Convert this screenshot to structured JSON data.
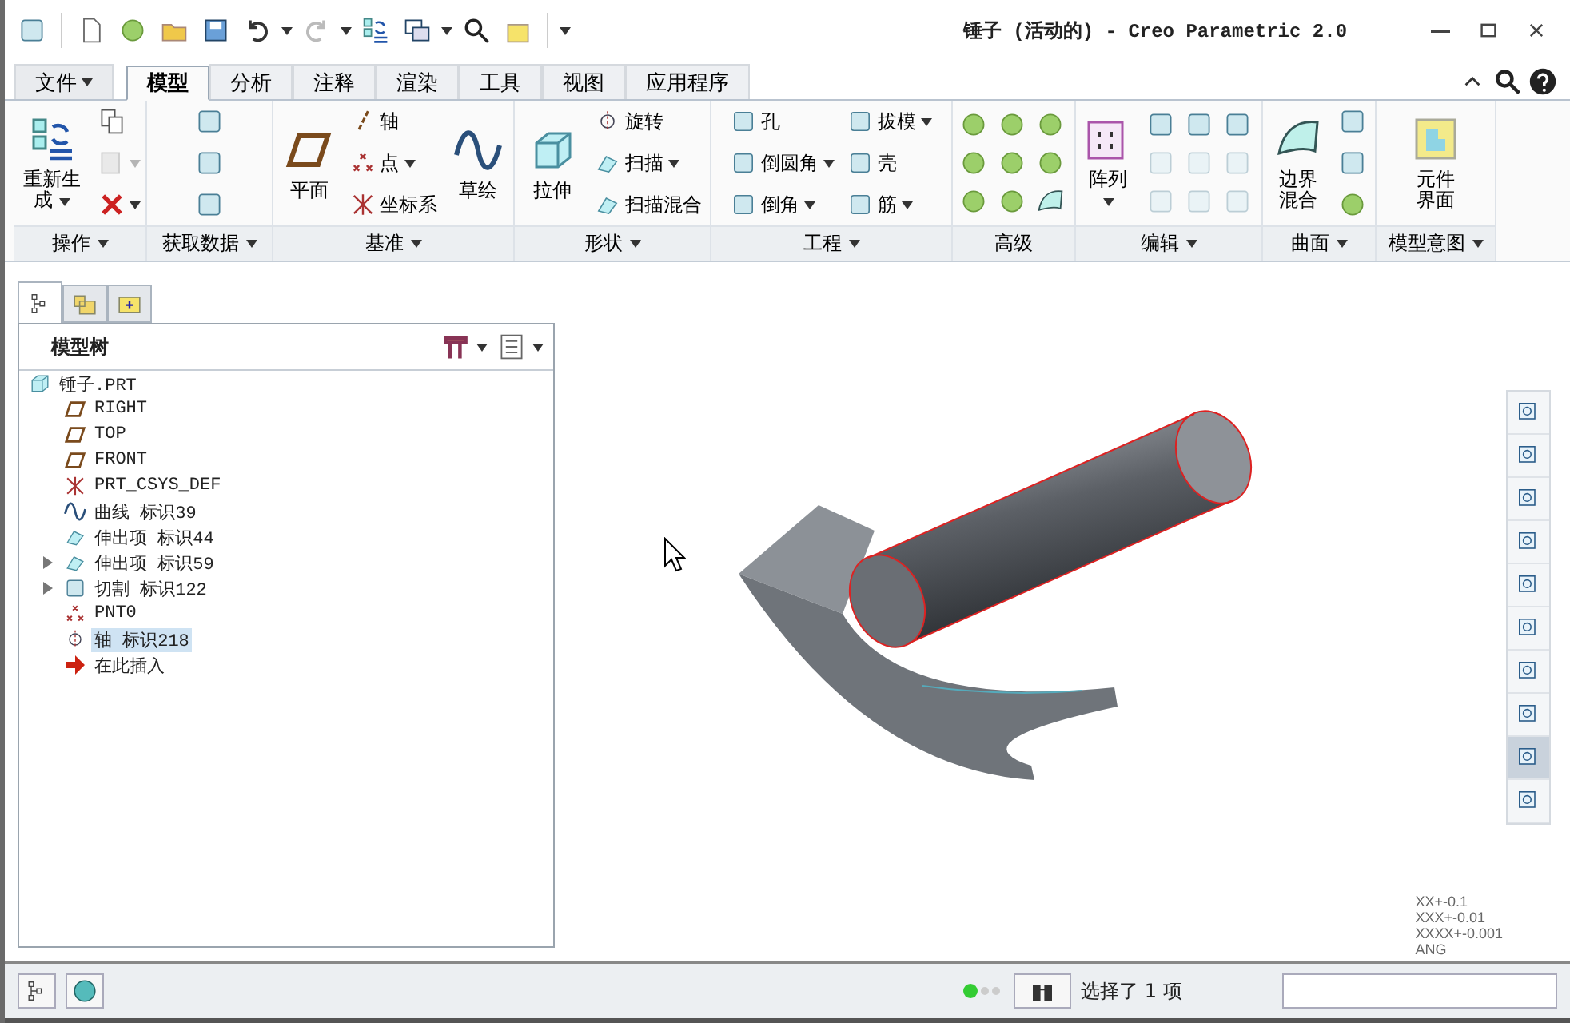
{
  "window": {
    "title": "锤子 (活动的) - Creo Parametric 2.0"
  },
  "menu_tabs": [
    {
      "label": "文件",
      "kind": "menu",
      "selected": false
    },
    {
      "label": "模型",
      "kind": "tab",
      "selected": true
    },
    {
      "label": "分析",
      "kind": "tab",
      "selected": false
    },
    {
      "label": "注释",
      "kind": "tab",
      "selected": false
    },
    {
      "label": "渲染",
      "kind": "tab",
      "selected": false
    },
    {
      "label": "工具",
      "kind": "tab",
      "selected": false
    },
    {
      "label": "视图",
      "kind": "tab",
      "selected": false
    },
    {
      "label": "应用程序",
      "kind": "tab",
      "selected": false
    }
  ],
  "ribbon": {
    "groups": [
      {
        "label": "操作",
        "dropdown": true,
        "items": [
          {
            "kind": "large",
            "label": "重新生成",
            "dropdown": true
          },
          {
            "kind": "icon",
            "dropdown": false,
            "disabled": false
          },
          {
            "kind": "icon",
            "dropdown": true,
            "disabled": true
          },
          {
            "kind": "icon",
            "dropdown": true,
            "disabled": false
          }
        ]
      },
      {
        "label": "获取数据",
        "dropdown": true,
        "items": [
          {
            "kind": "icon",
            "dropdown": false,
            "disabled": false
          },
          {
            "kind": "icon",
            "dropdown": false,
            "disabled": false
          },
          {
            "kind": "icon",
            "dropdown": false,
            "disabled": false
          }
        ]
      },
      {
        "label": "基准",
        "dropdown": true,
        "items": [
          {
            "kind": "large",
            "label": "平面",
            "dropdown": false
          },
          {
            "kind": "small",
            "label": "轴",
            "dropdown": false
          },
          {
            "kind": "small",
            "label": "点",
            "dropdown": true
          },
          {
            "kind": "small",
            "label": "坐标系",
            "dropdown": false
          },
          {
            "kind": "large",
            "label": "草绘",
            "dropdown": false
          }
        ]
      },
      {
        "label": "形状",
        "dropdown": true,
        "items": [
          {
            "kind": "large",
            "label": "拉伸",
            "dropdown": false
          },
          {
            "kind": "small",
            "label": "旋转",
            "dropdown": false
          },
          {
            "kind": "small",
            "label": "扫描",
            "dropdown": true
          },
          {
            "kind": "small",
            "label": "扫描混合",
            "dropdown": false
          }
        ]
      },
      {
        "label": "工程",
        "dropdown": true,
        "items": [
          {
            "kind": "small",
            "label": "孔",
            "dropdown": false
          },
          {
            "kind": "small",
            "label": "倒圆角",
            "dropdown": true
          },
          {
            "kind": "small",
            "label": "倒角",
            "dropdown": true
          },
          {
            "kind": "small",
            "label": "拔模",
            "dropdown": true
          },
          {
            "kind": "small",
            "label": "壳",
            "dropdown": false
          },
          {
            "kind": "small",
            "label": "筋",
            "dropdown": true
          }
        ]
      },
      {
        "label": "高级",
        "dropdown": false,
        "items": [
          {
            "kind": "icon",
            "dropdown": false,
            "disabled": false
          },
          {
            "kind": "icon",
            "dropdown": false,
            "disabled": false
          },
          {
            "kind": "icon",
            "dropdown": false,
            "disabled": false
          },
          {
            "kind": "icon",
            "dropdown": false,
            "disabled": false
          },
          {
            "kind": "icon",
            "dropdown": false,
            "disabled": false
          },
          {
            "kind": "icon",
            "dropdown": false,
            "disabled": false
          },
          {
            "kind": "icon",
            "dropdown": false,
            "disabled": false
          },
          {
            "kind": "icon",
            "dropdown": false,
            "disabled": false
          },
          {
            "kind": "icon",
            "dropdown": false,
            "disabled": false
          }
        ]
      },
      {
        "label": "编辑",
        "dropdown": true,
        "items": [
          {
            "kind": "large",
            "label": "阵列",
            "dropdown": true
          },
          {
            "kind": "icon",
            "dropdown": false,
            "disabled": false
          },
          {
            "kind": "icon",
            "dropdown": false,
            "disabled": false
          },
          {
            "kind": "icon",
            "dropdown": false,
            "disabled": false
          },
          {
            "kind": "icon",
            "dropdown": false,
            "disabled": true
          },
          {
            "kind": "icon",
            "dropdown": false,
            "disabled": true
          },
          {
            "kind": "icon",
            "dropdown": false,
            "disabled": true
          },
          {
            "kind": "icon",
            "dropdown": false,
            "disabled": true
          },
          {
            "kind": "icon",
            "dropdown": false,
            "disabled": true
          },
          {
            "kind": "icon",
            "dropdown": false,
            "disabled": true
          }
        ]
      },
      {
        "label": "曲面",
        "dropdown": true,
        "items": [
          {
            "kind": "large",
            "label": "边界混合",
            "dropdown": false
          },
          {
            "kind": "icon",
            "dropdown": false,
            "disabled": false
          },
          {
            "kind": "icon",
            "dropdown": false,
            "disabled": false
          },
          {
            "kind": "icon",
            "dropdown": false,
            "disabled": false
          }
        ]
      },
      {
        "label": "模型意图",
        "dropdown": true,
        "items": [
          {
            "kind": "large",
            "label": "元件界面",
            "dropdown": false
          }
        ]
      }
    ]
  },
  "navigator": {
    "tabs": [
      {
        "selected": true
      },
      {
        "selected": false
      },
      {
        "selected": false
      }
    ],
    "title": "模型树",
    "tree": [
      {
        "label": "锤子.PRT",
        "selected": false,
        "children": [
          {
            "label": "RIGHT",
            "selected": false
          },
          {
            "label": "TOP",
            "selected": false
          },
          {
            "label": "FRONT",
            "selected": false
          },
          {
            "label": "PRT_CSYS_DEF",
            "selected": false
          },
          {
            "label": "曲线 标识39",
            "selected": false
          },
          {
            "label": "伸出项 标识44",
            "selected": false
          },
          {
            "label": "伸出项 标识59",
            "selected": false,
            "expanded": false
          },
          {
            "label": "切割 标识122",
            "selected": false,
            "expanded": false
          },
          {
            "label": "PNT0",
            "selected": false
          },
          {
            "label": "轴 标识218",
            "selected": true
          },
          {
            "label": "在此插入",
            "selected": false
          }
        ]
      }
    ]
  },
  "graphics": {
    "tolerances": [
      "XX+-0.1",
      "XXX+-0.01",
      "XXXX+-0.001",
      "ANG"
    ]
  },
  "view_toolbar": [
    {
      "selected": false
    },
    {
      "selected": false
    },
    {
      "selected": false
    },
    {
      "selected": false
    },
    {
      "selected": false
    },
    {
      "selected": false
    },
    {
      "selected": false
    },
    {
      "selected": false
    },
    {
      "selected": true
    },
    {
      "selected": false
    }
  ],
  "status_bar": {
    "message": "选择了 1 项"
  }
}
